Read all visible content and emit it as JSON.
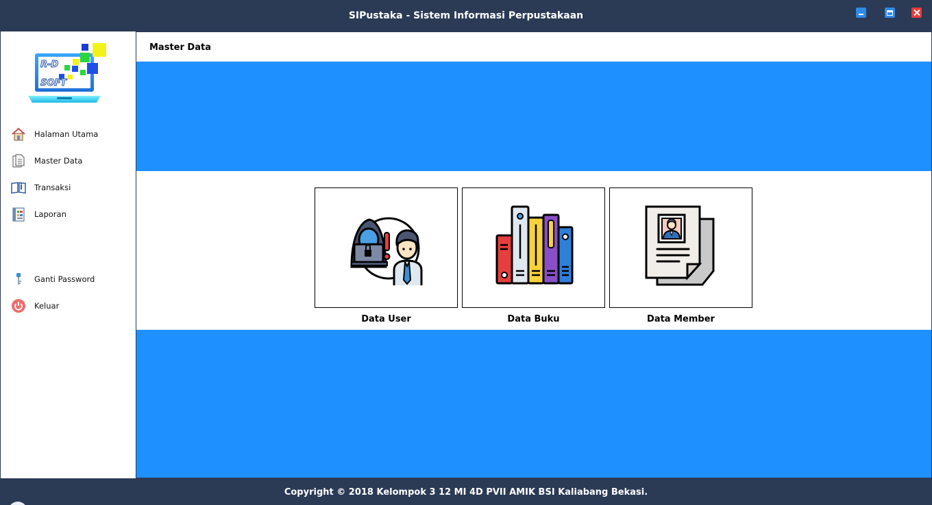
{
  "window": {
    "title": "SIPustaka - Sistem Informasi Perpustakaan",
    "controls": [
      "minimize-icon",
      "maximize-icon",
      "close-icon"
    ]
  },
  "sidebar": {
    "logo": {
      "text_line1": "R-D",
      "text_line2": "SOFT"
    },
    "items": [
      {
        "label": "Halaman Utama",
        "icon": "home-icon"
      },
      {
        "label": "Master Data",
        "icon": "document-icon"
      },
      {
        "label": "Transaksi",
        "icon": "book-icon"
      },
      {
        "label": "Laporan",
        "icon": "report-icon"
      },
      {
        "label": "Ganti Password",
        "icon": "key-icon"
      },
      {
        "label": "Keluar",
        "icon": "power-icon"
      }
    ]
  },
  "main": {
    "title": "Master Data",
    "cards": [
      {
        "label": "Data User",
        "icon": "hacker-user-icon"
      },
      {
        "label": "Data Buku",
        "icon": "books-icon"
      },
      {
        "label": "Data Member",
        "icon": "member-document-icon"
      }
    ]
  },
  "footer": {
    "text": "Copyright © 2018 Kelompok 3 12 MI 4D PVII AMIK BSI Kaliabang Bekasi."
  },
  "colors": {
    "frame": "#2b3a55",
    "accent_band": "#1e90ff",
    "window_button": "#2f8be6",
    "close_button": "#e83b3b"
  }
}
